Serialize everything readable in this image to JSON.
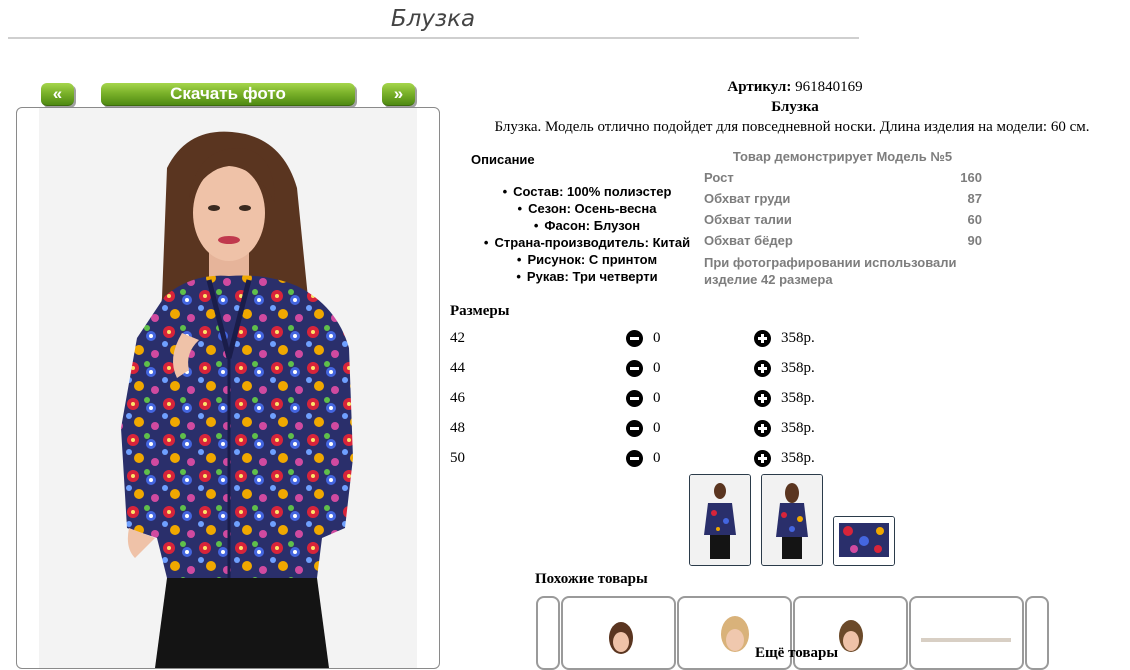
{
  "page": {
    "title": "Блузка"
  },
  "gallery": {
    "prev_label": "«",
    "download_label": "Скачать фото",
    "next_label": "»"
  },
  "product": {
    "article_label": "Артикул:",
    "article_value": "961840169",
    "name": "Блузка",
    "description": "Блузка. Модель отлично подойдет для повседневной носки. Длина изделия на модели: 60 см."
  },
  "description_block": {
    "heading": "Описание",
    "items": [
      "Состав: 100% полиэстер",
      "Сезон: Осень-весна",
      "Фасон: Блузон",
      "Страна-производитель: Китай",
      "Рисунок: С принтом",
      "Рукав: Три четверти"
    ]
  },
  "model": {
    "heading": "Товар демонстрирует Модель №5",
    "rows": [
      {
        "label": "Рост",
        "value": "160"
      },
      {
        "label": "Обхват груди",
        "value": "87"
      },
      {
        "label": "Обхват талии",
        "value": "60"
      },
      {
        "label": "Обхват бёдер",
        "value": "90"
      }
    ],
    "note": "При фотографировании использовали изделие 42 размера"
  },
  "sizes": {
    "heading": "Размеры",
    "rows": [
      {
        "size": "42",
        "qty": "0",
        "price": "358р."
      },
      {
        "size": "44",
        "qty": "0",
        "price": "358р."
      },
      {
        "size": "46",
        "qty": "0",
        "price": "358р."
      },
      {
        "size": "48",
        "qty": "0",
        "price": "358р."
      },
      {
        "size": "50",
        "qty": "0",
        "price": "358р."
      }
    ]
  },
  "similar": {
    "heading": "Похожие товары"
  },
  "more": {
    "heading": "Ещё товары"
  },
  "colors": {
    "button_green": "#6fa81f",
    "text_grey": "#7d7d7d",
    "thumb_border": "#2b3b4a"
  }
}
